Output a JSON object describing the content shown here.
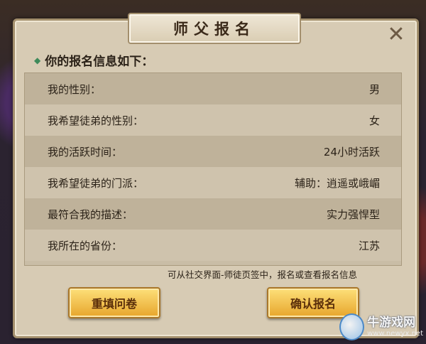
{
  "dialog": {
    "title": "师父报名",
    "close_label": "✕",
    "intro": "你的报名信息如下：",
    "rows": [
      {
        "label": "我的性别：",
        "value": "男"
      },
      {
        "label": "我希望徒弟的性别：",
        "value": "女"
      },
      {
        "label": "我的活跃时间：",
        "value": "24小时活跃"
      },
      {
        "label": "我希望徒弟的门派：",
        "value": "辅助：逍遥或峨嵋"
      },
      {
        "label": "最符合我的描述：",
        "value": "实力强悍型"
      },
      {
        "label": "我所在的省份：",
        "value": "江苏"
      }
    ],
    "hint": "可从社交界面-师徒页签中，报名或查看报名信息",
    "buttons": {
      "refill": "重填问卷",
      "confirm": "确认报名"
    }
  },
  "watermark": {
    "name": "牛游戏网",
    "url": "www.newyx.net"
  },
  "colors": {
    "panel_bg": "#d7cbb4",
    "button_gold": "#f2c14e",
    "text_dark": "#2b2218"
  }
}
